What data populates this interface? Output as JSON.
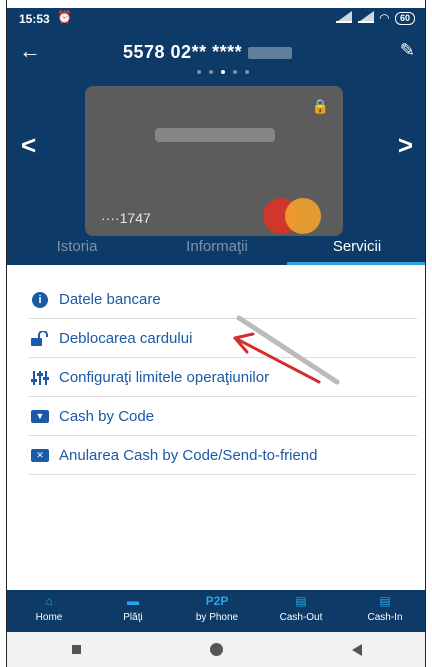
{
  "status_bar": {
    "time": "15:53",
    "battery": "60"
  },
  "header": {
    "title": "5578 02** ****",
    "card_last_digits": "····1747"
  },
  "tabs": [
    {
      "label": "Istoria"
    },
    {
      "label": "Informaţii"
    },
    {
      "label": "Servicii"
    }
  ],
  "services": [
    {
      "label": "Datele bancare",
      "icon": "info-icon"
    },
    {
      "label": "Deblocarea cardului",
      "icon": "unlock-icon"
    },
    {
      "label": "Configuraţi limitele operaţiunilor",
      "icon": "sliders-icon"
    },
    {
      "label": "Cash by Code",
      "icon": "cash-code-icon"
    },
    {
      "label": "Anularea Cash by Code/Send-to-friend",
      "icon": "cancel-cash-icon"
    }
  ],
  "bottom_nav": [
    {
      "label": "Home",
      "icon": "home-icon"
    },
    {
      "label": "Plăţi",
      "icon": "wallet-icon"
    },
    {
      "top": "P2P",
      "label": "by Phone",
      "icon": "p2p-icon"
    },
    {
      "label": "Cash-Out",
      "icon": "cash-out-icon"
    },
    {
      "label": "Cash-In",
      "icon": "cash-in-icon"
    }
  ],
  "colors": {
    "header_bg": "#0d3a66",
    "accent": "#33a3e0",
    "link": "#1a5aa6",
    "arrow": "#d32f2f"
  }
}
